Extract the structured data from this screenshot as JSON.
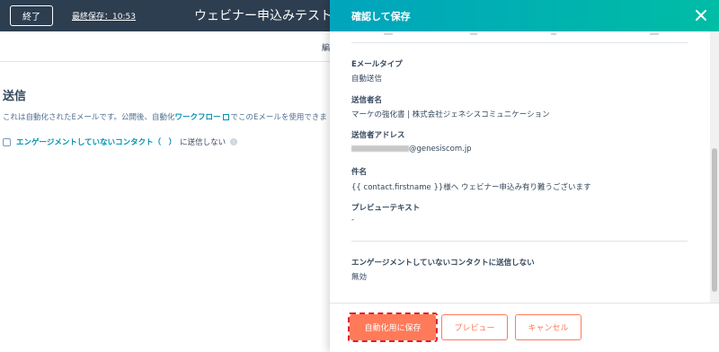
{
  "header": {
    "exit_label": "終了",
    "last_saved": "最終保存：10:53",
    "title": "ウェビナー申込みテスト"
  },
  "subbar": {
    "fragment": "編"
  },
  "send_section": {
    "heading": "送信",
    "desc_before": "これは自動化されたEメールです。公開後、自動化",
    "desc_link": "ワークフロー",
    "desc_after": "でこのEメールを使用できま",
    "checkbox_link": "エンゲージメントしていないコンタクト（　）",
    "checkbox_text": "に送信しない"
  },
  "panel": {
    "title": "確認して保存",
    "fields": [
      {
        "label": "Eメールタイプ",
        "value": "自動送信"
      },
      {
        "label": "送信者名",
        "value": "マーケの強化書 | 株式会社ジェネシスコミュニケーション"
      },
      {
        "label": "送信者アドレス",
        "value": "@genesiscom.jp"
      },
      {
        "label": "件名",
        "value": "{{ contact.firstname }}様へ ウェビナー申込み有り難うございます"
      },
      {
        "label": "プレビューテキスト",
        "value": "-"
      },
      {
        "label": "エンゲージメントしていないコンタクトに送信しない",
        "value": "無効"
      }
    ],
    "buttons": {
      "save": "自動化用に保存",
      "preview": "プレビュー",
      "cancel": "キャンセル"
    }
  },
  "colors": {
    "topbar": "#2d3e50",
    "header_gradient_start": "#00a4bd",
    "header_gradient_end": "#00bda5",
    "primary": "#ff7a59",
    "link": "#0091ae",
    "highlight": "#e0202b"
  }
}
